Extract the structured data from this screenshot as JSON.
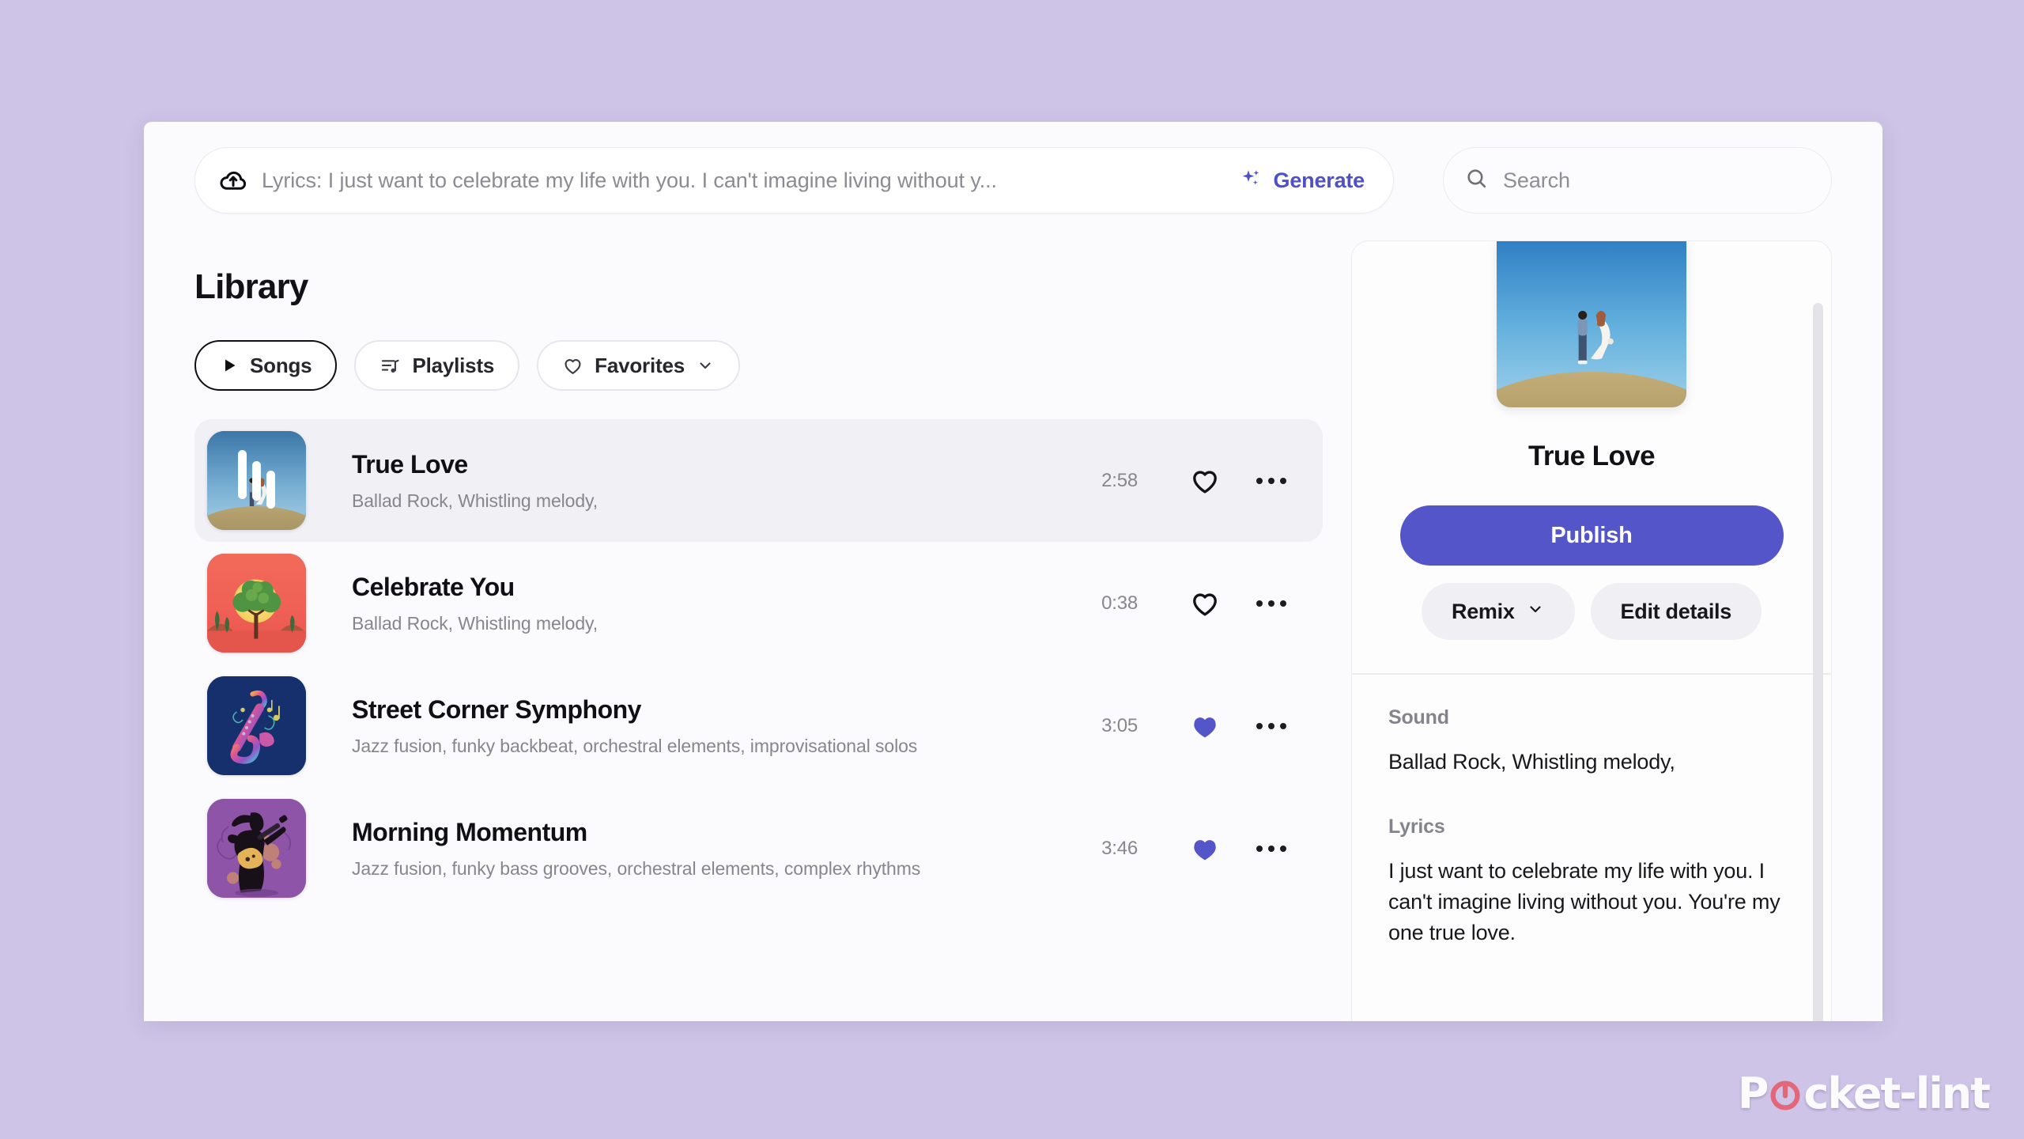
{
  "theme": {
    "page_background": "#cdc4e7",
    "card_background": "#fbfafc",
    "accent_purple": "#5355c9",
    "generate_purple": "#4e50c8",
    "muted_text": "#86868f",
    "title_text": "#101014",
    "selected_row": "#f1f0f5",
    "ghost_button": "#f0eff4"
  },
  "topbar": {
    "upload_icon": "cloud-upload-icon",
    "prompt_value": "Lyrics: I just want to celebrate my life with you. I can't imagine living without y...",
    "generate_label": "Generate",
    "generate_icon": "sparkles-icon",
    "search_icon": "search-icon",
    "search_placeholder": "Search"
  },
  "library": {
    "title": "Library",
    "chips": [
      {
        "label": "Songs",
        "icon": "play-icon",
        "active": true
      },
      {
        "label": "Playlists",
        "icon": "playlist-icon",
        "active": false
      },
      {
        "label": "Favorites",
        "icon": "heart-outline-icon",
        "active": false,
        "caret": "chevron-down-icon"
      }
    ],
    "songs": [
      {
        "title": "True Love",
        "tags": "Ballad Rock, Whistling melody,",
        "duration": "2:58",
        "favorited": false,
        "playing": true,
        "selected": true,
        "art": "couple-on-hill-photo"
      },
      {
        "title": "Celebrate You",
        "tags": "Ballad Rock, Whistling melody,",
        "duration": "0:38",
        "favorited": false,
        "playing": false,
        "selected": false,
        "art": "sunset-tree-illustration"
      },
      {
        "title": "Street Corner Symphony",
        "tags": "Jazz fusion, funky backbeat, orchestral elements, improvisational solos",
        "duration": "3:05",
        "favorited": true,
        "playing": false,
        "selected": false,
        "art": "saxophone-illustration"
      },
      {
        "title": "Morning Momentum",
        "tags": "Jazz fusion, funky bass grooves, orchestral elements, complex rhythms",
        "duration": "3:46",
        "favorited": true,
        "playing": false,
        "selected": false,
        "art": "guitarist-silhouette-illustration"
      }
    ]
  },
  "detail": {
    "cover_art": "couple-on-hill-photo",
    "title": "True Love",
    "publish_label": "Publish",
    "remix_label": "Remix",
    "remix_caret": "chevron-down-icon",
    "edit_details_label": "Edit details",
    "sound_label": "Sound",
    "sound_value": "Ballad Rock, Whistling melody,",
    "lyrics_label": "Lyrics",
    "lyrics_value": "I just want to celebrate my life with you. I can't imagine living without you. You're my one true love."
  },
  "watermark": {
    "text_before": "P",
    "text_after": "cket-lint",
    "icon": "power-icon"
  }
}
